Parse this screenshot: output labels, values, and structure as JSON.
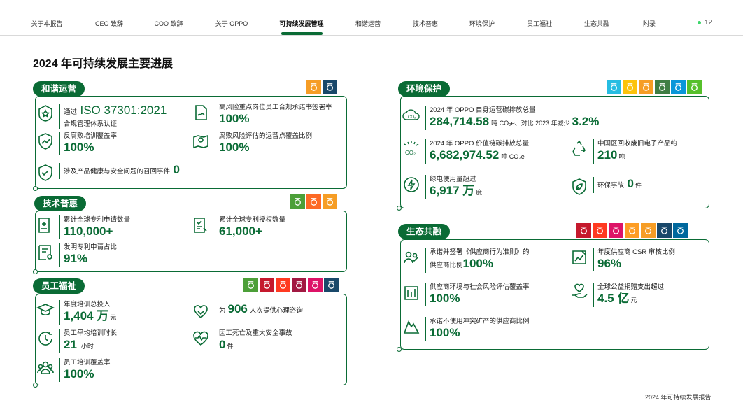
{
  "nav": {
    "items": [
      "关于本报告",
      "CEO 致辞",
      "COO 致辞",
      "关于 OPPO",
      "可持续发展管理",
      "和谐运营",
      "技术普惠",
      "环境保护",
      "员工福祉",
      "生态共融",
      "附录"
    ],
    "page_number": "12"
  },
  "page_title": "2024 年可持续发展主要进展",
  "footer": "2024 年可持续发展报告",
  "colors": {
    "brand_green": "#0a6b35",
    "page_dot": "#3dd66b"
  },
  "sections": {
    "harmony": {
      "title": "和谐运营",
      "metrics": {
        "iso": {
          "pre": "通过",
          "value": "ISO 37301:2021",
          "label": "合规管理体系认证",
          "icon": "badge-icon"
        },
        "commitment": {
          "label": "高风险重点岗位员工合规承诺书签署率",
          "value": "100%",
          "icon": "document-sign-icon"
        },
        "training": {
          "label": "反腐败培训覆盖率",
          "value": "100%",
          "icon": "shield-growth-icon"
        },
        "risk": {
          "label": "腐败风险评估的运营点覆盖比例",
          "value": "100%",
          "icon": "map-pin-icon"
        },
        "recall": {
          "label": "涉及产品健康与安全问题的召回事件",
          "value": "0",
          "icon": "shield-check-icon"
        }
      }
    },
    "tech": {
      "title": "技术普惠",
      "metrics": {
        "apply": {
          "label": "累计全球专利申请数量",
          "value": "110,000+",
          "icon": "patent-apply-icon"
        },
        "grant": {
          "label": "累计全球专利授权数量",
          "value": "61,000+",
          "icon": "patent-grant-icon"
        },
        "invention": {
          "label": "发明专利申请占比",
          "value": "91%",
          "icon": "certificate-icon"
        }
      }
    },
    "employee": {
      "title": "员工福祉",
      "metrics": {
        "invest": {
          "label": "年度培训总投入",
          "value": "1,404 万",
          "unit": "元",
          "icon": "graduation-cap-icon"
        },
        "psych": {
          "pre": "为",
          "value": "906",
          "post": "人次提供心理咨询",
          "icon": "heart-hands-icon"
        },
        "hours": {
          "label": "员工平均培训时长",
          "value": "21",
          "unit": "小时",
          "icon": "clock-icon"
        },
        "accident": {
          "label": "因工死亡及重大安全事故",
          "value": "0",
          "unit": "件",
          "icon": "heart-pulse-icon"
        },
        "coverage": {
          "label": "员工培训覆盖率",
          "value": "100%",
          "icon": "people-icon"
        }
      }
    },
    "environment": {
      "title": "环境保护",
      "metrics": {
        "own": {
          "label": "2024 年 OPPO 自身运营碳排放总量",
          "value": "284,714.58",
          "unit": "吨 CO₂e、对比 2023 年减少",
          "value2": "3.2%",
          "icon": "co2-cloud-icon"
        },
        "chain": {
          "label": "2024 年 OPPO 价值链碳排放总量",
          "value": "6,682,974.52",
          "unit": "吨 CO₂e",
          "icon": "co2-icon"
        },
        "recycle": {
          "label": "中国区回收废旧电子产品约",
          "value": "210",
          "unit": "吨",
          "icon": "recycle-icon"
        },
        "green": {
          "label": "绿电使用量超过",
          "value": "6,917 万",
          "unit": "度",
          "icon": "green-power-icon"
        },
        "incident": {
          "pre": "环保事故",
          "value": "0",
          "unit": "件",
          "icon": "leaf-shield-icon"
        }
      }
    },
    "ecosystem": {
      "title": "生态共融",
      "metrics": {
        "code": {
          "label": "承诺并签署《供应商行为准则》的",
          "pre": "供应商比例",
          "value": "100%",
          "icon": "supplier-people-icon"
        },
        "csr": {
          "label": "年度供应商 CSR 审核比例",
          "value": "96%",
          "icon": "audit-icon"
        },
        "assess": {
          "label": "供应商环境与社会风险评估覆盖率",
          "value": "100%",
          "icon": "factory-icon"
        },
        "donate": {
          "label": "全球公益捐赠支出超过",
          "value": "4.5 亿",
          "unit": "元",
          "icon": "charity-hands-icon"
        },
        "conflict": {
          "label": "承诺不使用冲突矿产的供应商比例",
          "value": "100%",
          "icon": "mountain-icon"
        }
      }
    }
  },
  "sdg_colors": {
    "harmony": [
      "#f69d25",
      "#19486a"
    ],
    "tech": [
      "#4c9f38",
      "#fd6925",
      "#f69d25"
    ],
    "employee": [
      "#4c9f38",
      "#c5192d",
      "#ff3a21",
      "#a21942",
      "#dd1367",
      "#19486a"
    ],
    "environment": [
      "#26bde2",
      "#fcc30b",
      "#f69d25",
      "#3f7e44",
      "#0a97d9",
      "#56c02b"
    ],
    "ecosystem": [
      "#c5192d",
      "#ff3a21",
      "#dd1367",
      "#fd9d24",
      "#f69d25",
      "#19486a",
      "#00689d"
    ]
  }
}
